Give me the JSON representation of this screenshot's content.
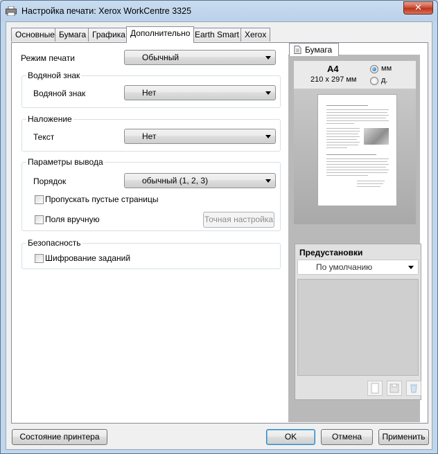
{
  "window": {
    "title": "Настройка печати: Xerox WorkCentre 3325",
    "close_label": "✕"
  },
  "tabs": [
    {
      "label": "Основные"
    },
    {
      "label": "Бумага"
    },
    {
      "label": "Графика"
    },
    {
      "label": "Дополнительно"
    },
    {
      "label": "Earth Smart"
    },
    {
      "label": "Xerox"
    }
  ],
  "print_mode": {
    "label": "Режим печати",
    "value": "Обычный"
  },
  "watermark": {
    "group": "Водяной знак",
    "label": "Водяной знак",
    "value": "Нет"
  },
  "overlay": {
    "group": "Наложение",
    "label": "Текст",
    "value": "Нет"
  },
  "output": {
    "group": "Параметры вывода",
    "order_label": "Порядок",
    "order_value": "обычный (1, 2, 3)",
    "skip_blank": "Пропускать пустые страницы",
    "manual_margins": "Поля вручную",
    "fine_tune": "Точная настройка"
  },
  "security": {
    "group": "Безопасность",
    "encrypt": "Шифрование заданий"
  },
  "preview": {
    "tab": "Бумага",
    "size_name": "A4",
    "size_dims": "210 x 297 мм",
    "unit_mm": "мм",
    "unit_in": "д."
  },
  "presets": {
    "title": "Предустановки",
    "value": "По умолчанию"
  },
  "footer": {
    "printer_status": "Состояние принтера",
    "ok": "OK",
    "cancel": "Отмена",
    "apply": "Применить"
  }
}
